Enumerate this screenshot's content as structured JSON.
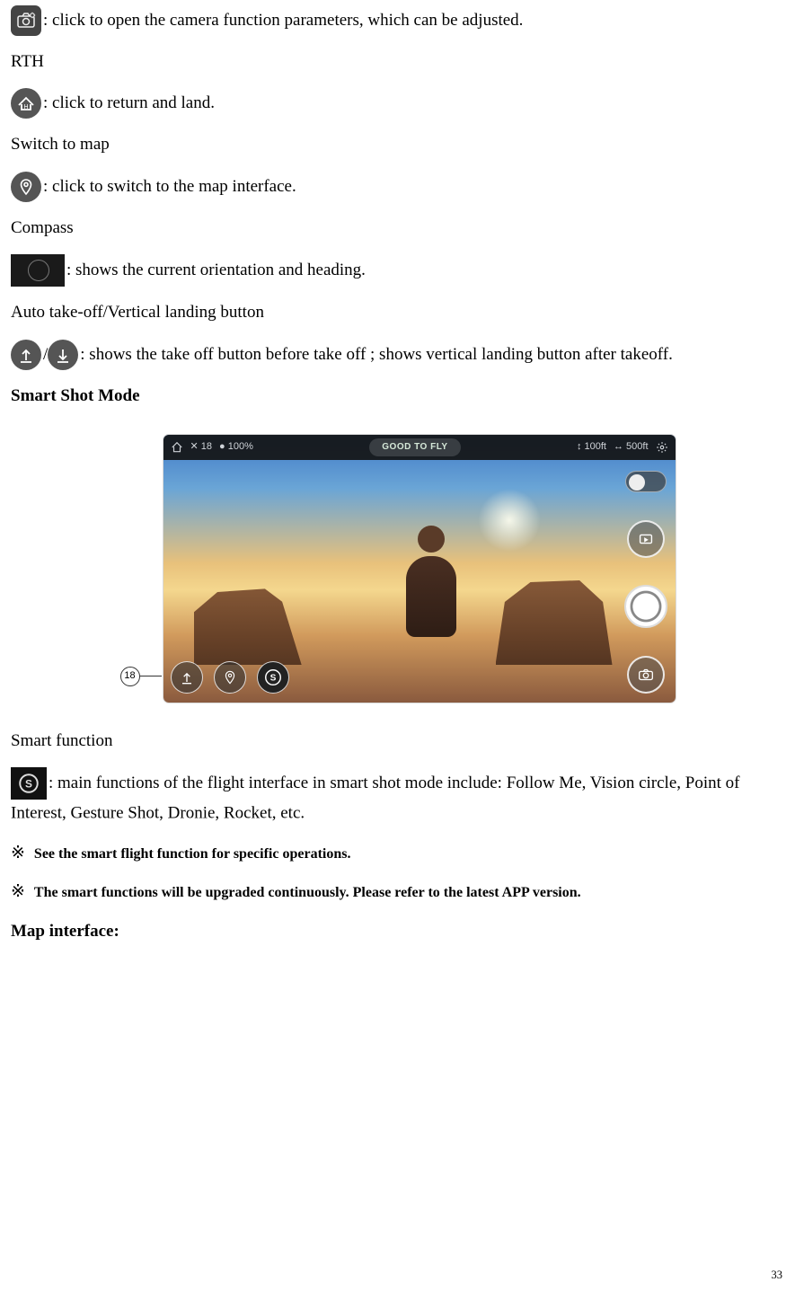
{
  "items": {
    "camera_params": {
      "text": ": click to open the camera function parameters, which can be adjusted."
    },
    "rth": {
      "label": "RTH",
      "text": ": click to return and land."
    },
    "switch_map": {
      "label": "Switch to map",
      "text": ": click to switch to the map interface."
    },
    "compass": {
      "label": "Compass",
      "text": ": shows the current orientation and heading."
    },
    "takeoff": {
      "label": "Auto take-off/Vertical landing button",
      "text": ": shows the take off button before take off ; shows vertical landing button after takeoff.",
      "slash": "/"
    },
    "smart": {
      "label": "Smart function",
      "text": ": main functions of the flight interface in smart shot mode include: Follow Me, Vision circle, Point of Interest, Gesture Shot, Dronie, Rocket, etc."
    }
  },
  "headings": {
    "smart_shot": "Smart Shot Mode",
    "map_interface": "Map interface:"
  },
  "notes": {
    "symbol": "※",
    "n1": "See the smart flight function for specific operations.",
    "n2": "The smart functions will be upgraded continuously. Please refer to the latest APP version."
  },
  "screenshot": {
    "callout": "18",
    "status": "GOOD TO FLY",
    "sat": "18",
    "batt": "100%",
    "alt": "100ft",
    "dist": "500ft",
    "sat_prefix": "✕ ",
    "batt_prefix": "● ",
    "alt_prefix": "↕ ",
    "dist_prefix": "↔ "
  },
  "page_number": "33"
}
